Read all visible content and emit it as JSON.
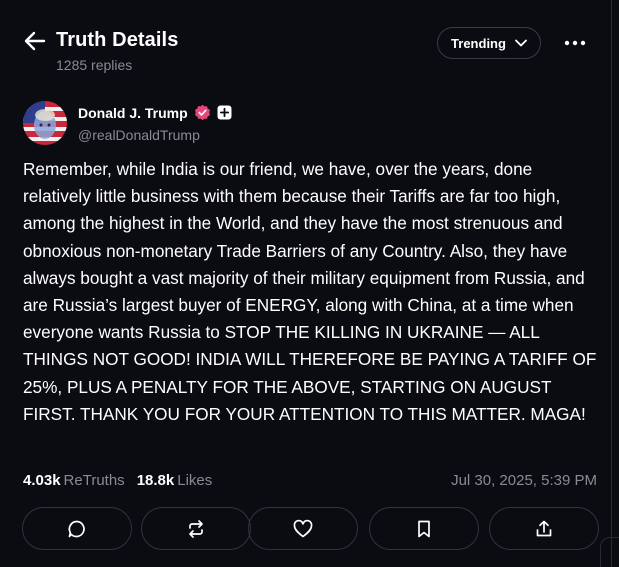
{
  "header": {
    "title": "Truth Details",
    "replies": "1285 replies",
    "back_icon": "arrow-left-icon",
    "sort": {
      "label": "Trending",
      "icon": "chevron-down-icon"
    },
    "more_icon": "more-horizontal-icon"
  },
  "post": {
    "author": {
      "name": "Donald J. Trump",
      "handle": "@realDonaldTrump",
      "verified_color": "#e8457a",
      "badge_icon": "plus-badge-icon"
    },
    "text": "Remember, while India is our friend, we have, over the years, done relatively little business with them because their Tariffs are far too high, among the highest in the World, and they have the most strenuous and obnoxious non-monetary Trade Barriers of any Country. Also, they have always bought a vast majority of their military equipment from Russia, and are Russia’s largest buyer of ENERGY, along with China, at a time when everyone wants Russia to STOP THE KILLING IN UKRAINE — ALL THINGS NOT GOOD! INDIA WILL THEREFORE BE PAYING A TARIFF OF 25%, PLUS A PENALTY FOR THE ABOVE, STARTING ON AUGUST FIRST. THANK YOU FOR YOUR ATTENTION TO THIS MATTER. MAGA!",
    "stats": {
      "retruths_count": "4.03k",
      "retruths_label": "ReTruths",
      "likes_count": "18.8k",
      "likes_label": "Likes"
    },
    "timestamp": "Jul 30, 2025, 5:39 PM"
  },
  "actions": [
    {
      "name": "reply",
      "icon": "comment-icon"
    },
    {
      "name": "retruth",
      "icon": "repost-icon"
    },
    {
      "name": "like",
      "icon": "heart-icon"
    },
    {
      "name": "bookmark",
      "icon": "bookmark-icon"
    },
    {
      "name": "share",
      "icon": "share-icon"
    }
  ],
  "colors": {
    "background": "#0b0b12",
    "muted_text": "#8a8a96",
    "border": "#33333d"
  }
}
